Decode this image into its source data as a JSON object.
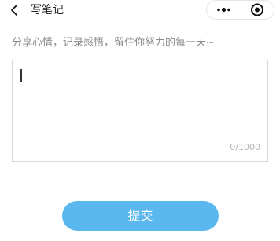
{
  "nav": {
    "back_icon": "chevron-left-icon",
    "title": "写笔记",
    "capsule": {
      "more_icon": "more-dots-icon",
      "close_icon": "target-circle-icon"
    }
  },
  "main": {
    "hint": "分享心情，记录感悟，留住你努力的每一天~",
    "note": {
      "value": "",
      "counter": "0/1000"
    },
    "submit_label": "提交"
  },
  "colors": {
    "accent": "#5ab8ef",
    "hint_text": "#8a8a8a",
    "border": "#d9d9d9"
  }
}
